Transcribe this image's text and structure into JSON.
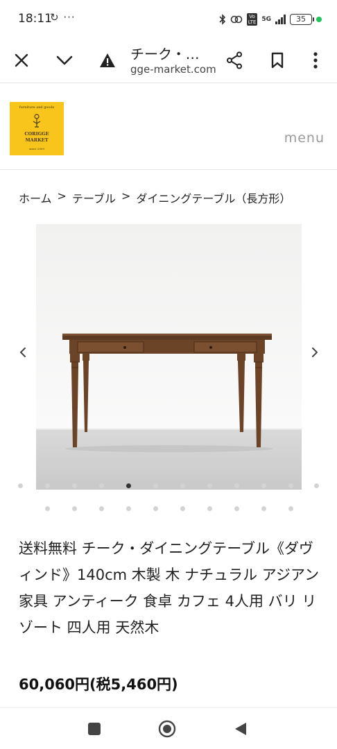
{
  "status_bar": {
    "time": "18:11",
    "left_icons": "↻ ···",
    "lte_label": "Vo\nLTE",
    "network": "5G",
    "battery": "35"
  },
  "browser": {
    "title": "チーク・…",
    "url": "gge-market.com"
  },
  "site": {
    "logo": {
      "tagline": "furniture and goods",
      "name_line1": "CORIGGE",
      "name_line2": "MARKET",
      "since": "since 2009"
    },
    "menu_label": "menu"
  },
  "breadcrumb": {
    "items": [
      "ホーム",
      "テーブル",
      "ダイニングテーブル（長方形）"
    ],
    "separator": ">"
  },
  "gallery": {
    "total_images": 12,
    "active_index": 4
  },
  "product": {
    "title": "送料無料 チーク・ダイニングテーブル《ダヴィンド》140cm 木製 木 ナチュラル アジアン家具 アンティーク 食卓 カフェ 4人用 バリ リゾート 四人用 天然木",
    "price": "60,060円(税5,460円)"
  },
  "colors": {
    "logo_bg": "#f7c51c",
    "wood": "#6b4326",
    "dot_active": "#333333",
    "dot_inactive": "#d3d3d3"
  }
}
